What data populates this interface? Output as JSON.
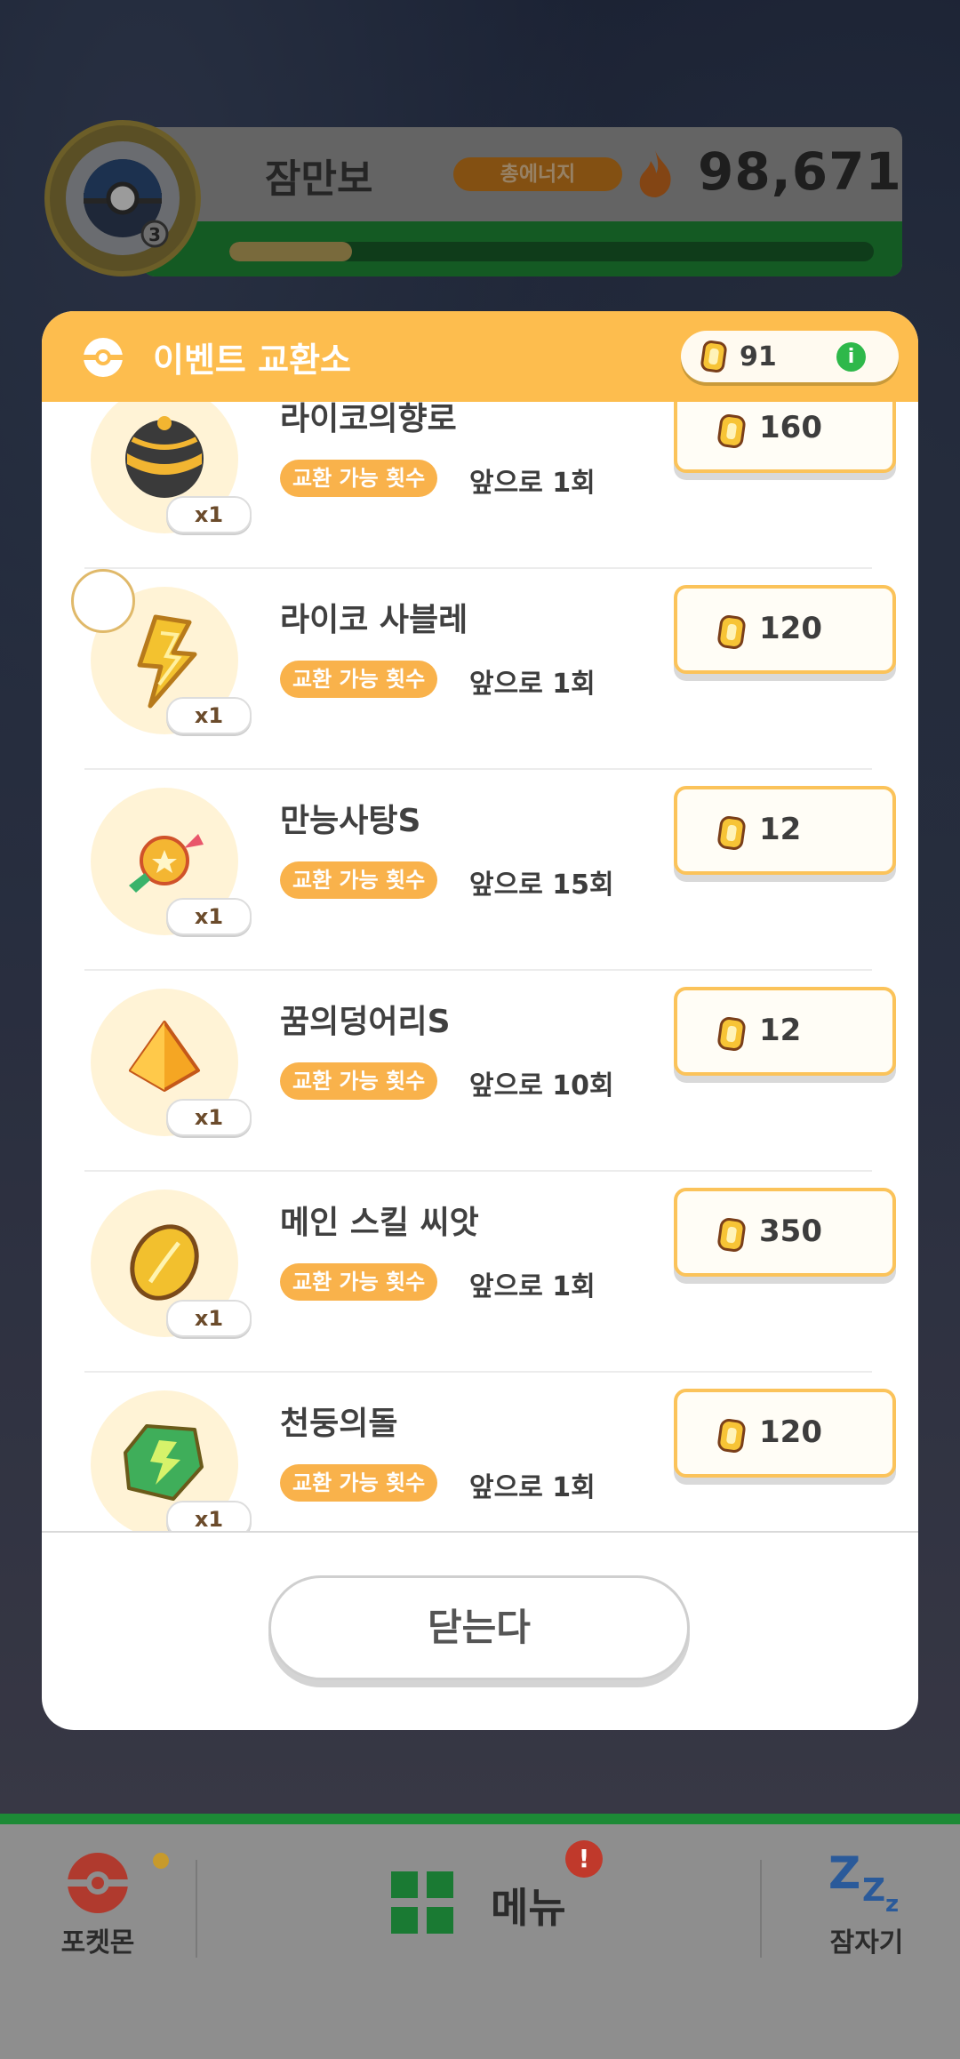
{
  "profile": {
    "name": "잠만보",
    "energy_label": "총에너지",
    "energy_value": "98,671",
    "progress_fraction": 0.19,
    "avatar_level": "3"
  },
  "exchange": {
    "title": "이벤트 교환소",
    "coin_balance": "91",
    "info_icon": "i",
    "items": [
      {
        "name": "라이코의향로",
        "qty": "x1",
        "limit_label": "교환 가능 횟수",
        "limit_text": "앞으로 1회",
        "price": "160",
        "icon": "incense-ball-icon"
      },
      {
        "name": "라이코 사블레",
        "qty": "x1",
        "limit_label": "교환 가능 횟수",
        "limit_text": "앞으로 1회",
        "price": "120",
        "icon": "lightning-biscuit-icon"
      },
      {
        "name": "만능사탕S",
        "qty": "x1",
        "limit_label": "교환 가능 횟수",
        "limit_text": "앞으로 15회",
        "price": "12",
        "icon": "candy-icon"
      },
      {
        "name": "꿈의덩어리S",
        "qty": "x1",
        "limit_label": "교환 가능 횟수",
        "limit_text": "앞으로 10회",
        "price": "12",
        "icon": "dream-shard-icon"
      },
      {
        "name": "메인 스킬 씨앗",
        "qty": "x1",
        "limit_label": "교환 가능 횟수",
        "limit_text": "앞으로 1회",
        "price": "350",
        "icon": "skill-seed-icon"
      },
      {
        "name": "천둥의돌",
        "qty": "x1",
        "limit_label": "교환 가능 횟수",
        "limit_text": "앞으로 1회",
        "price": "120",
        "icon": "thunder-stone-icon"
      }
    ],
    "close_label": "닫는다"
  },
  "nav": {
    "pokemon_label": "포켓몬",
    "menu_label": "메뉴",
    "menu_badge": "!",
    "sleep_label": "잠자기"
  },
  "colors": {
    "header": "#fdbd4e",
    "tag": "#f9b24b",
    "accent_green": "#1d8a36"
  }
}
